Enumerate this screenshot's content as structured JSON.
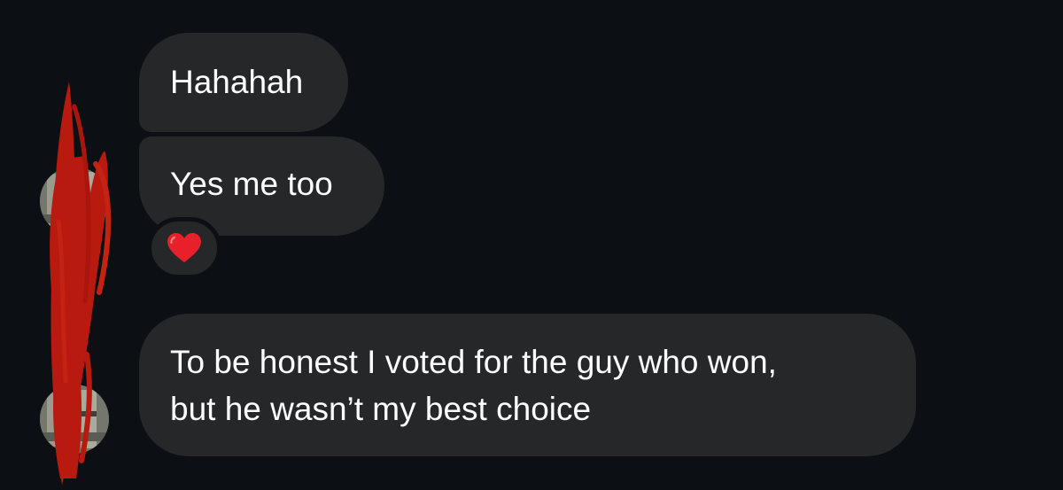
{
  "messages": [
    {
      "text": "Hahahah"
    },
    {
      "text": "Yes me too",
      "reaction": "heart-emoji"
    },
    {
      "lines": [
        "To be honest I voted for the guy who won,",
        "but he wasn’t my best choice"
      ]
    }
  ],
  "colors": {
    "background": "#0c0f13",
    "bubble": "#262729",
    "text": "#ffffff",
    "heart": "#e8202a",
    "redaction": "#b81a10"
  }
}
